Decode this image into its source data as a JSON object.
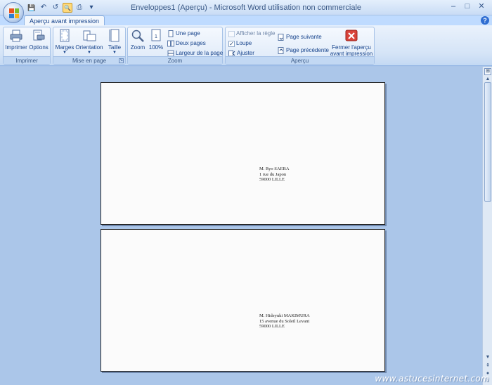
{
  "window": {
    "title": "Enveloppes1 (Aperçu) - Microsoft Word utilisation non commerciale",
    "controls": {
      "minimize": "–",
      "maximize": "□",
      "close": "✕"
    }
  },
  "qat": {
    "save_icon": "💾",
    "undo_icon": "↶",
    "redo_icon": "↺",
    "preview_icon": "🔍",
    "print_icon": "⎙",
    "customize_icon": "▾"
  },
  "tabs": {
    "active_tab": "Aperçu avant impression",
    "help": "?"
  },
  "ribbon": {
    "imprimer": {
      "label": "Imprimer",
      "print_button": "Imprimer",
      "options_button": "Options"
    },
    "mise_en_page": {
      "label": "Mise en page",
      "margins_button": "Marges",
      "orientation_button": "Orientation",
      "size_button": "Taille"
    },
    "zoom": {
      "label": "Zoom",
      "zoom_button": "Zoom",
      "percent_button": "100%",
      "one_page": "Une page",
      "two_pages": "Deux pages",
      "page_width": "Largeur de la page"
    },
    "apercu": {
      "label": "Aperçu",
      "show_ruler": "Afficher la règle",
      "magnifier": "Loupe",
      "shrink": "Ajuster",
      "next_page": "Page suivante",
      "prev_page": "Page précédente",
      "close_preview_line1": "Fermer l'aperçu",
      "close_preview_line2": "avant impression"
    }
  },
  "envelopes": [
    {
      "line1": "M. Ryo SAEBA",
      "line2": "1 rue du Japon",
      "line3": "59000 LILLE"
    },
    {
      "line1": "M. Hideyuki MAKIMURA",
      "line2": "15 avenue du Soleil Levant",
      "line3": "59000 LILLE"
    }
  ],
  "watermark": "www.astucesinternet.com",
  "colors": {
    "accent": "#15428b",
    "workspace": "#abc6e9",
    "close_red": "#d9433a"
  }
}
